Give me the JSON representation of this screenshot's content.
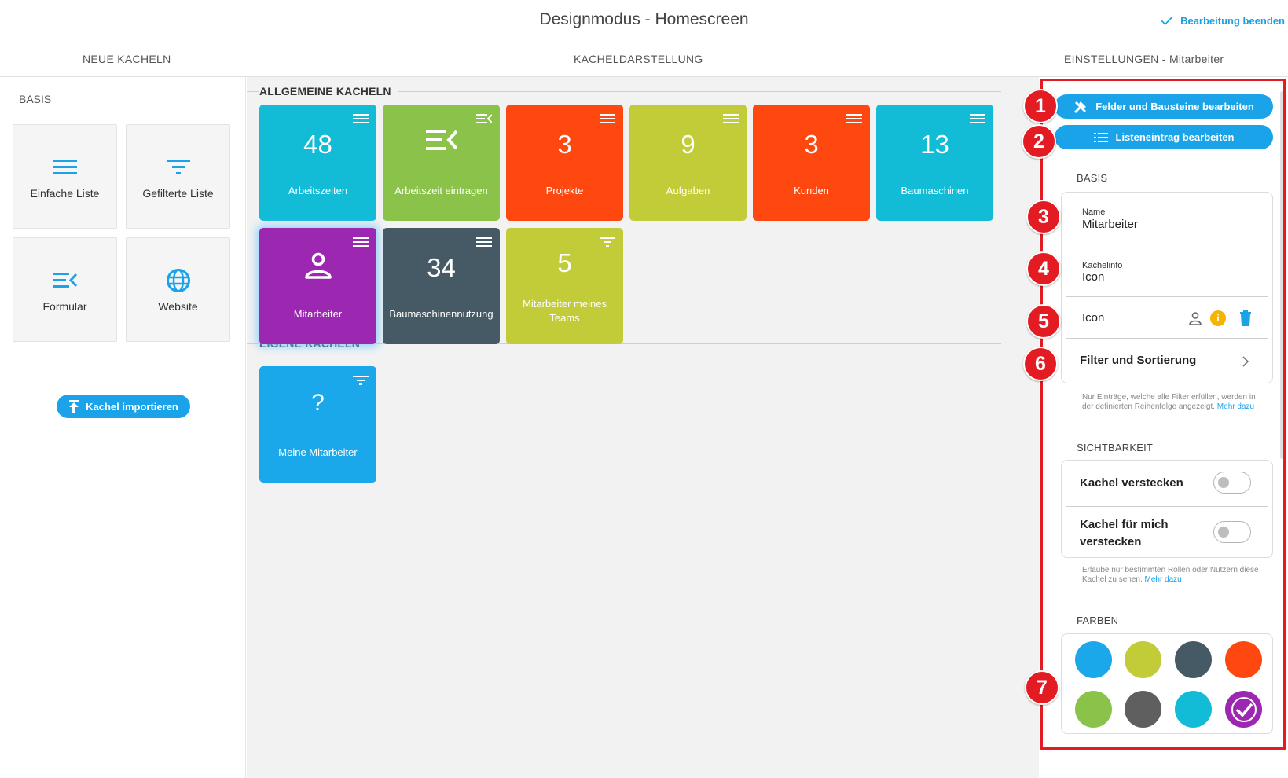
{
  "header": {
    "title": "Designmodus - Homescreen",
    "finish_label": "Bearbeitung beenden"
  },
  "columns": {
    "left": "NEUE KACHELN",
    "middle": "KACHELDARSTELLUNG",
    "right": "EINSTELLUNGEN - Mitarbeiter"
  },
  "left_panel": {
    "section": "BASIS",
    "tiles": [
      {
        "label": "Einfache Liste",
        "icon": "list-icon"
      },
      {
        "label": "Gefilterte Liste",
        "icon": "filter-icon"
      },
      {
        "label": "Formular",
        "icon": "form-icon"
      },
      {
        "label": "Website",
        "icon": "globe-icon"
      }
    ],
    "import_label": "Kachel importieren"
  },
  "middle": {
    "general_label": "ALLGEMEINE KACHELN",
    "own_label": "EIGENE KACHELN",
    "tiles": [
      {
        "number": "48",
        "label": "Arbeitszeiten",
        "color": "#12bcd6",
        "menu": "menu-icon"
      },
      {
        "number": "",
        "label": "Arbeitszeit eintragen",
        "color": "#8bc34a",
        "menu": "form-menu-icon"
      },
      {
        "number": "3",
        "label": "Projekte",
        "color": "#ff4810",
        "menu": "menu-icon"
      },
      {
        "number": "9",
        "label": "Aufgaben",
        "color": "#c1cc38",
        "menu": "menu-icon"
      },
      {
        "number": "3",
        "label": "Kunden",
        "color": "#ff4810",
        "menu": "menu-icon"
      },
      {
        "number": "13",
        "label": "Baumaschinen",
        "color": "#12bcd6",
        "menu": "menu-icon"
      },
      {
        "number": "",
        "label": "Mitarbeiter",
        "color": "#9c27b0",
        "menu": "menu-icon"
      },
      {
        "number": "34",
        "label": "Baumaschinennutzung",
        "color": "#455a64",
        "menu": "menu-icon"
      },
      {
        "number": "5",
        "label": "Mitarbeiter meines Teams",
        "color": "#c1cc38",
        "menu": "filter-icon"
      }
    ],
    "own_tiles": [
      {
        "number": "?",
        "label": "Meine Mitarbeiter",
        "color": "#1aa8ea",
        "menu": "filter-icon"
      }
    ]
  },
  "settings": {
    "btn_fields": "Felder und Bausteine bearbeiten",
    "btn_list": "Listeneintrag bearbeiten",
    "basis_label": "BASIS",
    "name_label": "Name",
    "name_value": "Mitarbeiter",
    "info_label": "Kachelinfo",
    "info_value": "Icon",
    "icon_label": "Icon",
    "filter_label": "Filter und Sortierung",
    "filter_hint": "Nur Einträge, welche alle Filter erfüllen, werden in der definierten Reihenfolge angezeigt.",
    "filter_hint_link": "Mehr dazu",
    "visibility_label": "SICHTBARKEIT",
    "hide_tile": "Kachel verstecken",
    "hide_for_me": "Kachel für mich verstecken",
    "visibility_hint": "Erlaube nur bestimmten Rollen oder Nutzern diese Kachel zu sehen.",
    "visibility_hint_link": "Mehr dazu",
    "colors_label": "FARBEN",
    "colors": [
      "#1aa8ea",
      "#c1cc38",
      "#455a64",
      "#ff4810",
      "#8bc34a",
      "#5f5f5f",
      "#12bcd6",
      "#9c27b0"
    ],
    "selected_color": "#9c27b0"
  },
  "annotations": [
    "1",
    "2",
    "3",
    "4",
    "5",
    "6",
    "7"
  ]
}
